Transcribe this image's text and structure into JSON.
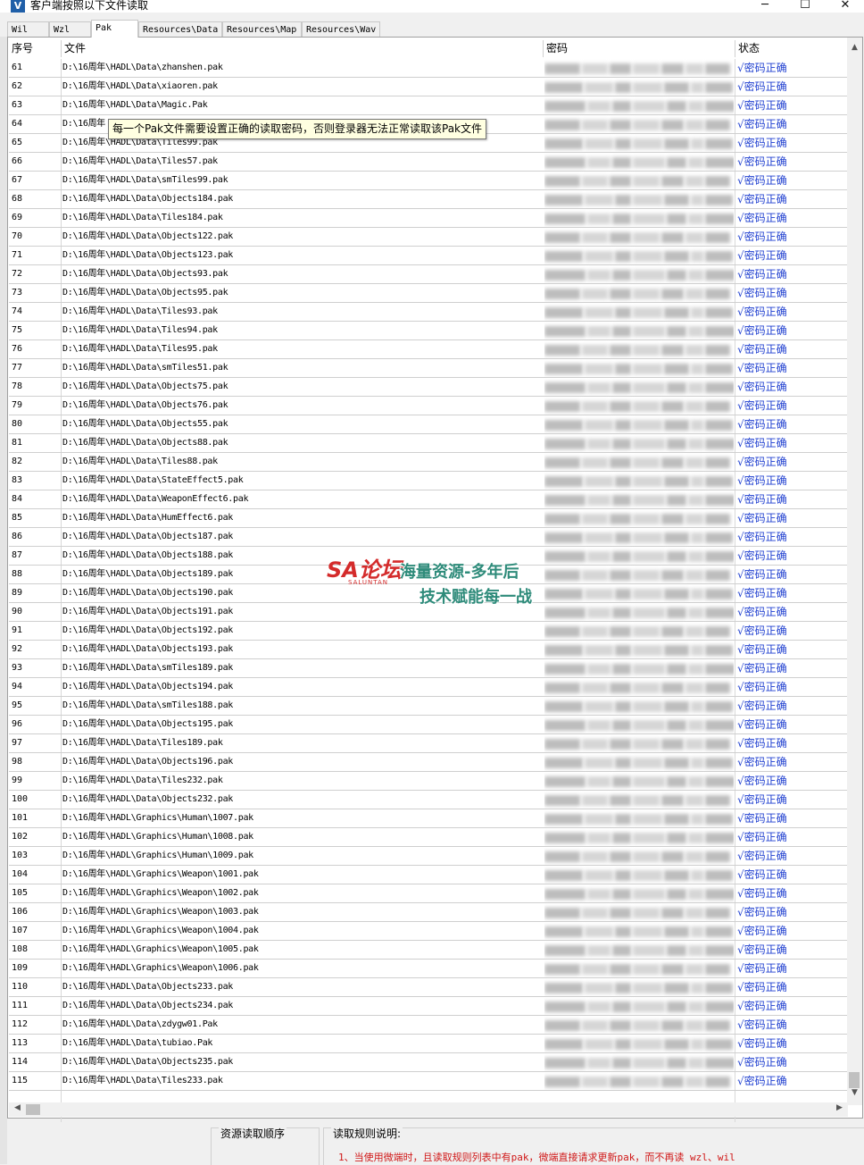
{
  "window": {
    "title": "客户端按照以下文件读取",
    "minimize": "─",
    "maximize": "☐",
    "close": "✕"
  },
  "tabs": [
    {
      "label": "Wil"
    },
    {
      "label": "Wzl"
    },
    {
      "label": "Pak",
      "active": true
    },
    {
      "label": "Resources\\Data"
    },
    {
      "label": "Resources\\Map"
    },
    {
      "label": "Resources\\Wav"
    }
  ],
  "table": {
    "headers": {
      "index": "序号",
      "file": "文件",
      "password": "密码",
      "status": "状态"
    },
    "status_text": "√密码正确",
    "rows": [
      [
        "61",
        "D:\\16周年\\HADL\\Data\\zhanshen.pak"
      ],
      [
        "62",
        "D:\\16周年\\HADL\\Data\\xiaoren.pak"
      ],
      [
        "63",
        "D:\\16周年\\HADL\\Data\\Magic.Pak"
      ],
      [
        "64",
        "D:\\16周年"
      ],
      [
        "65",
        "D:\\16周年\\HADL\\Data\\Tiles99.pak"
      ],
      [
        "66",
        "D:\\16周年\\HADL\\Data\\Tiles57.pak"
      ],
      [
        "67",
        "D:\\16周年\\HADL\\Data\\smTiles99.pak"
      ],
      [
        "68",
        "D:\\16周年\\HADL\\Data\\Objects184.pak"
      ],
      [
        "69",
        "D:\\16周年\\HADL\\Data\\Tiles184.pak"
      ],
      [
        "70",
        "D:\\16周年\\HADL\\Data\\Objects122.pak"
      ],
      [
        "71",
        "D:\\16周年\\HADL\\Data\\Objects123.pak"
      ],
      [
        "72",
        "D:\\16周年\\HADL\\Data\\Objects93.pak"
      ],
      [
        "73",
        "D:\\16周年\\HADL\\Data\\Objects95.pak"
      ],
      [
        "74",
        "D:\\16周年\\HADL\\Data\\Tiles93.pak"
      ],
      [
        "75",
        "D:\\16周年\\HADL\\Data\\Tiles94.pak"
      ],
      [
        "76",
        "D:\\16周年\\HADL\\Data\\Tiles95.pak"
      ],
      [
        "77",
        "D:\\16周年\\HADL\\Data\\smTiles51.pak"
      ],
      [
        "78",
        "D:\\16周年\\HADL\\Data\\Objects75.pak"
      ],
      [
        "79",
        "D:\\16周年\\HADL\\Data\\Objects76.pak"
      ],
      [
        "80",
        "D:\\16周年\\HADL\\Data\\Objects55.pak"
      ],
      [
        "81",
        "D:\\16周年\\HADL\\Data\\Objects88.pak"
      ],
      [
        "82",
        "D:\\16周年\\HADL\\Data\\Tiles88.pak"
      ],
      [
        "83",
        "D:\\16周年\\HADL\\Data\\StateEffect5.pak"
      ],
      [
        "84",
        "D:\\16周年\\HADL\\Data\\WeaponEffect6.pak"
      ],
      [
        "85",
        "D:\\16周年\\HADL\\Data\\HumEffect6.pak"
      ],
      [
        "86",
        "D:\\16周年\\HADL\\Data\\Objects187.pak"
      ],
      [
        "87",
        "D:\\16周年\\HADL\\Data\\Objects188.pak"
      ],
      [
        "88",
        "D:\\16周年\\HADL\\Data\\Objects189.pak"
      ],
      [
        "89",
        "D:\\16周年\\HADL\\Data\\Objects190.pak"
      ],
      [
        "90",
        "D:\\16周年\\HADL\\Data\\Objects191.pak"
      ],
      [
        "91",
        "D:\\16周年\\HADL\\Data\\Objects192.pak"
      ],
      [
        "92",
        "D:\\16周年\\HADL\\Data\\Objects193.pak"
      ],
      [
        "93",
        "D:\\16周年\\HADL\\Data\\smTiles189.pak"
      ],
      [
        "94",
        "D:\\16周年\\HADL\\Data\\Objects194.pak"
      ],
      [
        "95",
        "D:\\16周年\\HADL\\Data\\smTiles188.pak"
      ],
      [
        "96",
        "D:\\16周年\\HADL\\Data\\Objects195.pak"
      ],
      [
        "97",
        "D:\\16周年\\HADL\\Data\\Tiles189.pak"
      ],
      [
        "98",
        "D:\\16周年\\HADL\\Data\\Objects196.pak"
      ],
      [
        "99",
        "D:\\16周年\\HADL\\Data\\Tiles232.pak"
      ],
      [
        "100",
        "D:\\16周年\\HADL\\Data\\Objects232.pak"
      ],
      [
        "101",
        "D:\\16周年\\HADL\\Graphics\\Human\\1007.pak"
      ],
      [
        "102",
        "D:\\16周年\\HADL\\Graphics\\Human\\1008.pak"
      ],
      [
        "103",
        "D:\\16周年\\HADL\\Graphics\\Human\\1009.pak"
      ],
      [
        "104",
        "D:\\16周年\\HADL\\Graphics\\Weapon\\1001.pak"
      ],
      [
        "105",
        "D:\\16周年\\HADL\\Graphics\\Weapon\\1002.pak"
      ],
      [
        "106",
        "D:\\16周年\\HADL\\Graphics\\Weapon\\1003.pak"
      ],
      [
        "107",
        "D:\\16周年\\HADL\\Graphics\\Weapon\\1004.pak"
      ],
      [
        "108",
        "D:\\16周年\\HADL\\Graphics\\Weapon\\1005.pak"
      ],
      [
        "109",
        "D:\\16周年\\HADL\\Graphics\\Weapon\\1006.pak"
      ],
      [
        "110",
        "D:\\16周年\\HADL\\Data\\Objects233.pak"
      ],
      [
        "111",
        "D:\\16周年\\HADL\\Data\\Objects234.pak"
      ],
      [
        "112",
        "D:\\16周年\\HADL\\Data\\zdygw01.Pak"
      ],
      [
        "113",
        "D:\\16周年\\HADL\\Data\\tubiao.Pak"
      ],
      [
        "114",
        "D:\\16周年\\HADL\\Data\\Objects235.pak"
      ],
      [
        "115",
        "D:\\16周年\\HADL\\Data\\Tiles233.pak"
      ]
    ]
  },
  "tooltip": "每一个Pak文件需要设置正确的读取密码，否则登录器无法正常读取该Pak文件",
  "watermark": {
    "logo": "SA论坛",
    "logo_sub": "SALUNTAN",
    "line1": "海量资源-多年后",
    "line2": "技术赋能每一战"
  },
  "bottom": {
    "order_label": "资源读取顺序",
    "rules_label": "读取规则说明:",
    "rule1": "1、当使用微端时，且读取规则列表中有pak，微端直接请求更新pak，而不再读 wzl、wil"
  },
  "colors": {
    "status": "#1f3fd0",
    "rule": "#d01818",
    "tooltip_bg": "#ffffe1"
  }
}
